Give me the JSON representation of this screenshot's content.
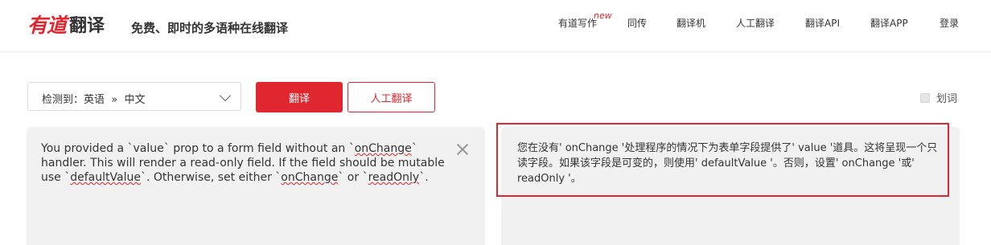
{
  "header": {
    "brand": "有道",
    "brand_suffix": "翻译",
    "slogan": "免费、即时的多语种在线翻译",
    "nav": [
      {
        "label": "有道写作"
      },
      {
        "label": "同传"
      },
      {
        "label": "翻译机"
      },
      {
        "label": "人工翻译"
      },
      {
        "label": "翻译API"
      },
      {
        "label": "翻译APP"
      },
      {
        "label": "登录"
      }
    ],
    "new_badge": "new"
  },
  "toolbar": {
    "lang_select": "检测到：英语  »  中文",
    "translate_button": "翻译",
    "human_button": "人工翻译",
    "dict_label": "划词"
  },
  "source": {
    "parts": [
      "You provided a `value` prop to a form field without an `",
      "onChange",
      "` handler. This will render a read-only field. If the field should be mutable use `",
      "defaultValue",
      "`. Otherwise, set either `",
      "onChange",
      "` or `",
      "readOnly",
      "`."
    ]
  },
  "target": {
    "text": "您在没有' onChange '处理程序的情况下为表单字段提供了' value '道具。这将呈现一个只读字段。如果该字段是可变的，则使用' defaultValue '。否则，设置' onChange '或' readOnly '。"
  },
  "colors": {
    "accent": "#e0262f",
    "panel": "#f1f1f1"
  },
  "icons": [
    "close-icon",
    "chevron-down-icon",
    "checkbox-icon"
  ]
}
